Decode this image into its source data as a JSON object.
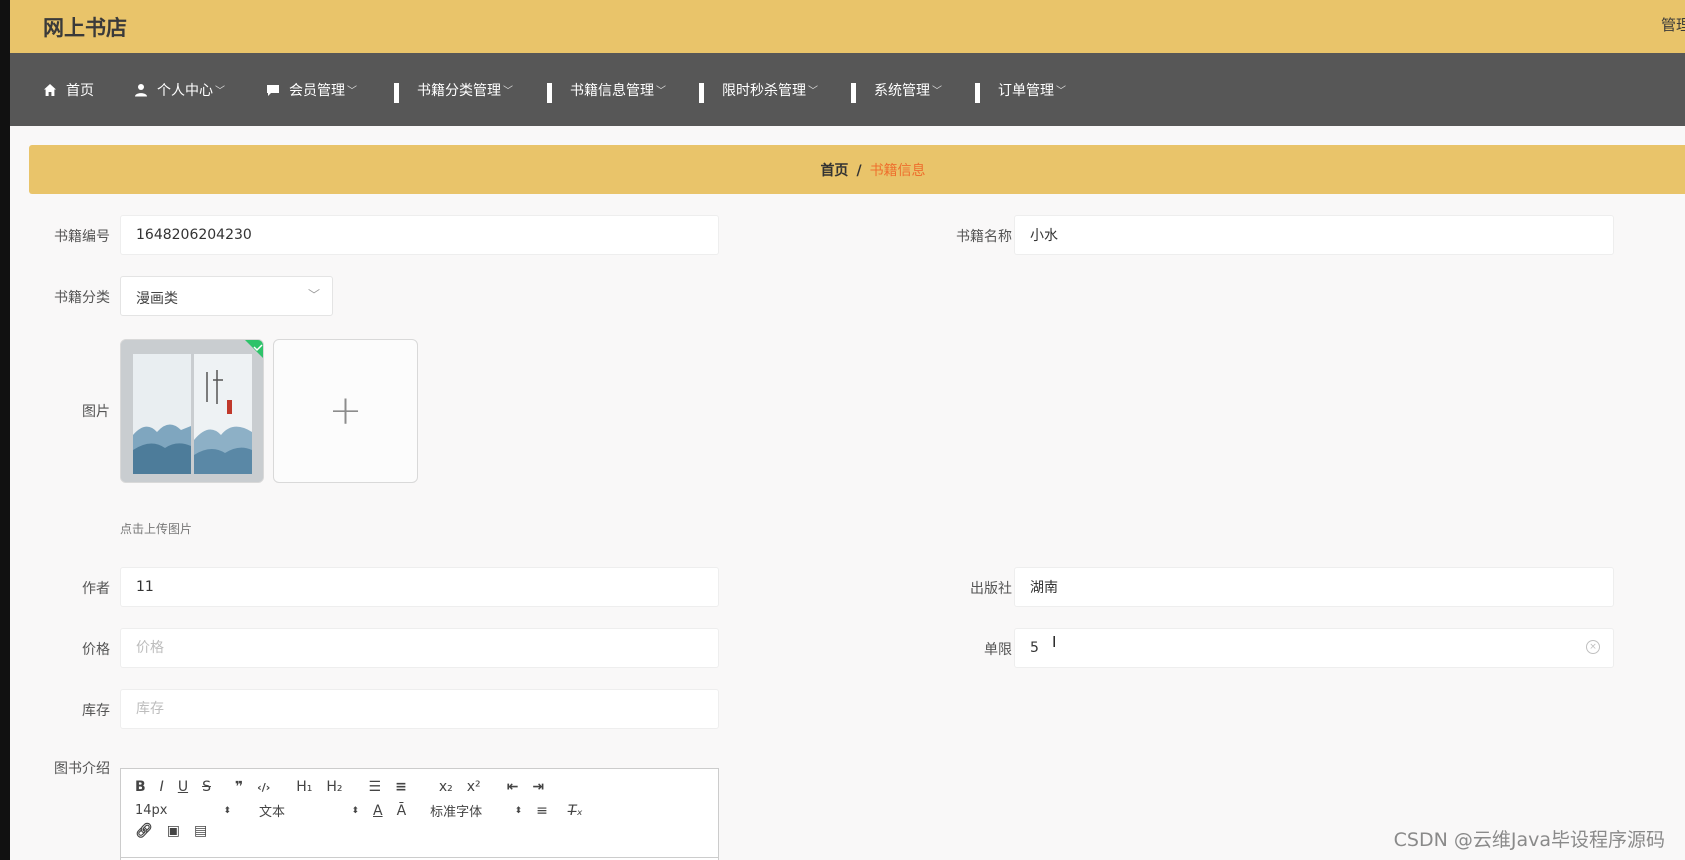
{
  "header": {
    "site_title": "网上书店",
    "right_text": "管理"
  },
  "nav": [
    {
      "label": "首页",
      "icon": "home-icon",
      "dropdown": false
    },
    {
      "label": "个人中心",
      "icon": "user-icon",
      "dropdown": true
    },
    {
      "label": "会员管理",
      "icon": "chat-icon",
      "dropdown": true
    },
    {
      "label": "书籍分类管理",
      "icon": "grid-icon",
      "dropdown": true
    },
    {
      "label": "书籍信息管理",
      "icon": "grid-icon",
      "dropdown": true
    },
    {
      "label": "限时秒杀管理",
      "icon": "grid-icon",
      "dropdown": true
    },
    {
      "label": "系统管理",
      "icon": "grid-icon",
      "dropdown": true
    },
    {
      "label": "订单管理",
      "icon": "grid-icon",
      "dropdown": true
    }
  ],
  "breadcrumb": {
    "home": "首页",
    "separator": "/",
    "current": "书籍信息"
  },
  "form": {
    "book_no": {
      "label": "书籍编号",
      "value": "1648206204230"
    },
    "book_name": {
      "label": "书籍名称",
      "value": "小水"
    },
    "category": {
      "label": "书籍分类",
      "value": "漫画类"
    },
    "image": {
      "label": "图片",
      "tip": "点击上传图片"
    },
    "author": {
      "label": "作者",
      "value": "11"
    },
    "publisher": {
      "label": "出版社",
      "value": "湖南"
    },
    "price": {
      "label": "价格",
      "placeholder": "价格",
      "value": ""
    },
    "limit": {
      "label": "单限",
      "value": "5"
    },
    "stock": {
      "label": "库存",
      "placeholder": "库存",
      "value": ""
    },
    "intro": {
      "label": "图书介绍"
    }
  },
  "editor": {
    "font_size": "14px",
    "text_type": "文本",
    "font_family": "标准字体"
  },
  "watermark": "CSDN @云维Java毕设程序源码",
  "colors": {
    "topbar": "#e9c46a",
    "navbar": "#575757",
    "accent": "#ee6f2d",
    "background": "#f9f8f8"
  }
}
